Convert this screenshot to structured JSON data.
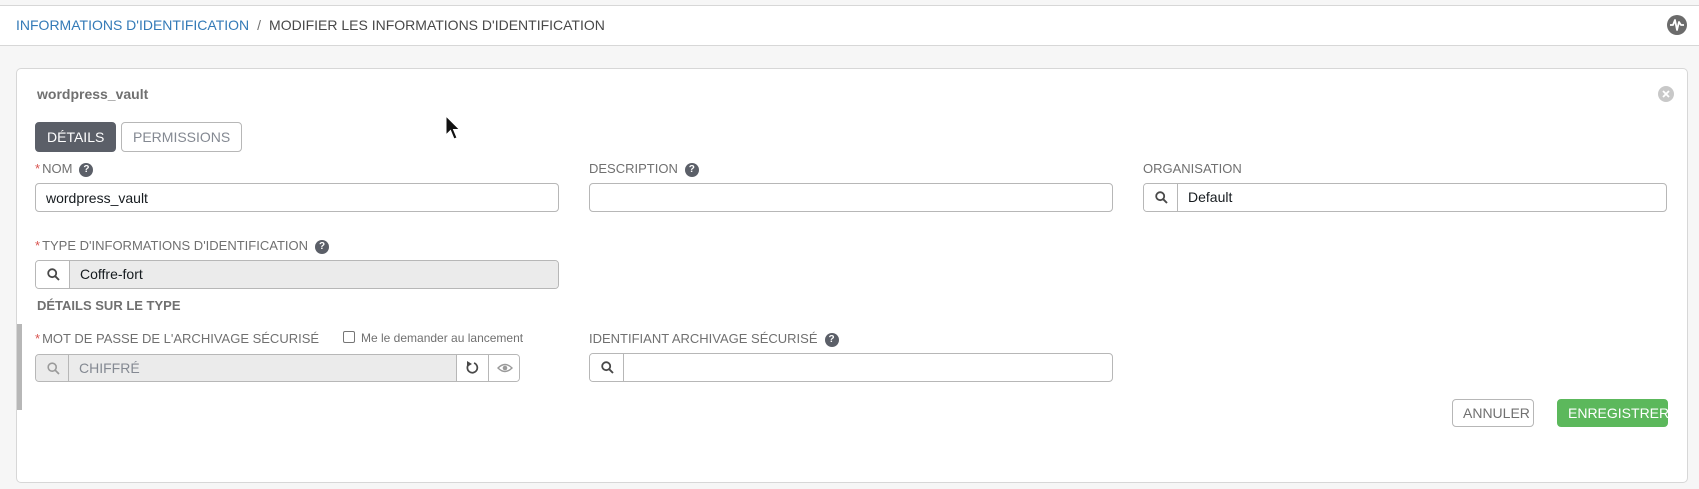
{
  "breadcrumb": {
    "parent": "INFORMATIONS D'IDENTIFICATION",
    "separator": "/",
    "current": "MODIFIER LES INFORMATIONS D'IDENTIFICATION"
  },
  "panel": {
    "title": "wordpress_vault"
  },
  "tabs": [
    {
      "label": "DÉTAILS",
      "active": true
    },
    {
      "label": "PERMISSIONS",
      "active": false
    }
  ],
  "fields": {
    "name": {
      "label": "NOM",
      "value": "wordpress_vault",
      "required": true
    },
    "description": {
      "label": "DESCRIPTION",
      "value": ""
    },
    "organization": {
      "label": "ORGANISATION",
      "value": "Default"
    },
    "credential_type": {
      "label": "TYPE D'INFORMATIONS D'IDENTIFICATION",
      "value": "Coffre-fort",
      "required": true
    }
  },
  "type_details": {
    "section_title": "DÉTAILS SUR LE TYPE",
    "vault_password": {
      "label": "MOT DE PASSE DE L'ARCHIVAGE SÉCURISÉ",
      "value": "CHIFFRÉ",
      "required": true
    },
    "ask_on_launch": {
      "label": "Me le demander au lancement",
      "checked": false
    },
    "vault_id": {
      "label": "IDENTIFIANT ARCHIVAGE SÉCURISÉ",
      "value": ""
    }
  },
  "actions": {
    "cancel": "ANNULER",
    "save": "ENREGISTRER"
  },
  "help_symbol": "?",
  "required_marker": "*",
  "icons": {
    "activity": "activity-stream-icon",
    "close": "close-icon",
    "help": "question-circle-icon",
    "search": "search-icon",
    "reset": "undo-icon",
    "reveal": "eye-icon"
  },
  "colors": {
    "link": "#337ab7",
    "save": "#5cb85c",
    "active_tab": "#5b5f68",
    "required": "#d9534f"
  }
}
